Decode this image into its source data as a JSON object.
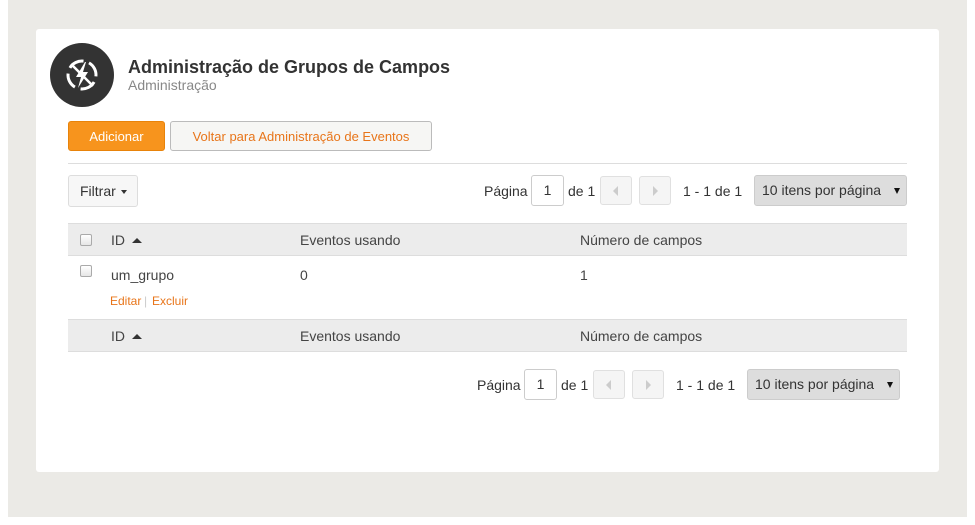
{
  "header": {
    "title": "Administração de Grupos de Campos",
    "subtitle": "Administração",
    "logo_icon": "lightning-bolt-icon"
  },
  "toolbar": {
    "add_label": "Adicionar",
    "back_label": "Voltar para Administração de Eventos"
  },
  "filter": {
    "label": "Filtrar"
  },
  "pagination": {
    "page_label": "Página",
    "current_page": "1",
    "of_label": "de 1",
    "range": "1 - 1 de 1",
    "per_page": "10 itens por página",
    "prev_icon": "chevron-left-icon",
    "next_icon": "chevron-right-icon"
  },
  "table": {
    "columns": [
      "ID",
      "Eventos usando",
      "Número de campos"
    ],
    "sort_column": "ID",
    "sort_direction": "ascending",
    "rows": [
      {
        "id": "um_grupo",
        "eventos": "0",
        "campos": "1",
        "edit_label": "Editar",
        "delete_label": "Excluir"
      }
    ]
  },
  "colors": {
    "accent": "#f7941d",
    "link": "#e8751a",
    "page_bg": "#ebeae6",
    "header_row": "#ececec"
  }
}
